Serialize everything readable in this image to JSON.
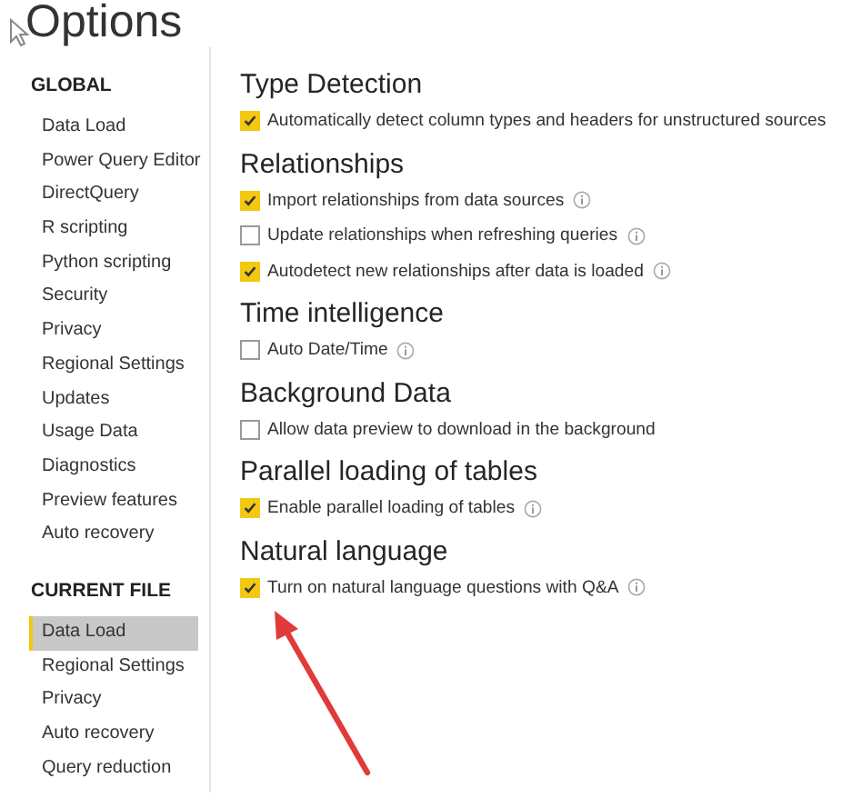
{
  "window": {
    "title": "Options"
  },
  "sidebar": {
    "groups": [
      {
        "heading": "GLOBAL",
        "items": [
          {
            "label": "Data Load",
            "selected": false
          },
          {
            "label": "Power Query Editor",
            "selected": false
          },
          {
            "label": "DirectQuery",
            "selected": false
          },
          {
            "label": "R scripting",
            "selected": false
          },
          {
            "label": "Python scripting",
            "selected": false
          },
          {
            "label": "Security",
            "selected": false
          },
          {
            "label": "Privacy",
            "selected": false
          },
          {
            "label": "Regional Settings",
            "selected": false
          },
          {
            "label": "Updates",
            "selected": false
          },
          {
            "label": "Usage Data",
            "selected": false
          },
          {
            "label": "Diagnostics",
            "selected": false
          },
          {
            "label": "Preview features",
            "selected": false
          },
          {
            "label": "Auto recovery",
            "selected": false
          }
        ]
      },
      {
        "heading": "CURRENT FILE",
        "items": [
          {
            "label": "Data Load",
            "selected": true
          },
          {
            "label": "Regional Settings",
            "selected": false
          },
          {
            "label": "Privacy",
            "selected": false
          },
          {
            "label": "Auto recovery",
            "selected": false
          },
          {
            "label": "Query reduction",
            "selected": false
          }
        ]
      }
    ]
  },
  "sections": [
    {
      "heading": "Type Detection",
      "options": [
        {
          "label": "Automatically detect column types and headers for unstructured sources",
          "checked": true,
          "info": false
        }
      ]
    },
    {
      "heading": "Relationships",
      "options": [
        {
          "label": "Import relationships from data sources",
          "checked": true,
          "info": true
        },
        {
          "label": "Update relationships when refreshing queries",
          "checked": false,
          "info": true
        },
        {
          "label": "Autodetect new relationships after data is loaded",
          "checked": true,
          "info": true
        }
      ]
    },
    {
      "heading": "Time intelligence",
      "options": [
        {
          "label": "Auto Date/Time",
          "checked": false,
          "info": true
        }
      ]
    },
    {
      "heading": "Background Data",
      "options": [
        {
          "label": "Allow data preview to download in the background",
          "checked": false,
          "info": false
        }
      ]
    },
    {
      "heading": "Parallel loading of tables",
      "options": [
        {
          "label": "Enable parallel loading of tables",
          "checked": true,
          "info": true
        }
      ]
    },
    {
      "heading": "Natural language",
      "options": [
        {
          "label": "Turn on natural language questions with Q&A",
          "checked": true,
          "info": true
        }
      ]
    }
  ]
}
